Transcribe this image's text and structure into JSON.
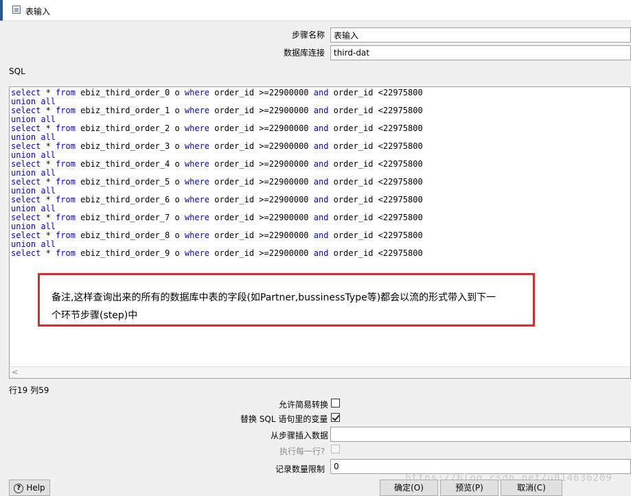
{
  "window": {
    "title": "表输入"
  },
  "form": {
    "step_name_label": "步骤名称",
    "step_name_value": "表输入",
    "connection_label": "数据库连接",
    "connection_value": "third-dat",
    "sql_label": "SQL"
  },
  "sql_lines": [
    [
      {
        "t": "select",
        "k": true
      },
      {
        "t": " * "
      },
      {
        "t": "from",
        "k": true
      },
      {
        "t": " ebiz_third_order_0 o "
      },
      {
        "t": "where",
        "k": true
      },
      {
        "t": " order_id >=22900000 "
      },
      {
        "t": "and",
        "k": true
      },
      {
        "t": " order_id <22975800"
      }
    ],
    [
      {
        "t": "union all",
        "k": true
      }
    ],
    [
      {
        "t": "select",
        "k": true
      },
      {
        "t": " * "
      },
      {
        "t": "from",
        "k": true
      },
      {
        "t": " ebiz_third_order_1 o "
      },
      {
        "t": "where",
        "k": true
      },
      {
        "t": " order_id >=22900000 "
      },
      {
        "t": "and",
        "k": true
      },
      {
        "t": " order_id <22975800"
      }
    ],
    [
      {
        "t": "union all",
        "k": true
      }
    ],
    [
      {
        "t": "select",
        "k": true
      },
      {
        "t": " * "
      },
      {
        "t": "from",
        "k": true
      },
      {
        "t": " ebiz_third_order_2 o "
      },
      {
        "t": "where",
        "k": true
      },
      {
        "t": " order_id >=22900000 "
      },
      {
        "t": "and",
        "k": true
      },
      {
        "t": " order_id <22975800"
      }
    ],
    [
      {
        "t": "union all",
        "k": true
      }
    ],
    [
      {
        "t": "select",
        "k": true
      },
      {
        "t": " * "
      },
      {
        "t": "from",
        "k": true
      },
      {
        "t": " ebiz_third_order_3 o "
      },
      {
        "t": "where",
        "k": true
      },
      {
        "t": " order_id >=22900000 "
      },
      {
        "t": "and",
        "k": true
      },
      {
        "t": " order_id <22975800"
      }
    ],
    [
      {
        "t": "union all",
        "k": true
      }
    ],
    [
      {
        "t": "select",
        "k": true
      },
      {
        "t": " * "
      },
      {
        "t": "from",
        "k": true
      },
      {
        "t": " ebiz_third_order_4 o "
      },
      {
        "t": "where",
        "k": true
      },
      {
        "t": " order_id >=22900000 "
      },
      {
        "t": "and",
        "k": true
      },
      {
        "t": " order_id <22975800"
      }
    ],
    [
      {
        "t": "union all",
        "k": true
      }
    ],
    [
      {
        "t": "select",
        "k": true
      },
      {
        "t": " * "
      },
      {
        "t": "from",
        "k": true
      },
      {
        "t": " ebiz_third_order_5 o "
      },
      {
        "t": "where",
        "k": true
      },
      {
        "t": " order_id >=22900000 "
      },
      {
        "t": "and",
        "k": true
      },
      {
        "t": " order_id <22975800"
      }
    ],
    [
      {
        "t": "union all",
        "k": true
      }
    ],
    [
      {
        "t": "select",
        "k": true
      },
      {
        "t": " * "
      },
      {
        "t": "from",
        "k": true
      },
      {
        "t": " ebiz_third_order_6 o "
      },
      {
        "t": "where",
        "k": true
      },
      {
        "t": " order_id >=22900000 "
      },
      {
        "t": "and",
        "k": true
      },
      {
        "t": " order_id <22975800"
      }
    ],
    [
      {
        "t": "union all",
        "k": true
      }
    ],
    [
      {
        "t": "select",
        "k": true
      },
      {
        "t": " * "
      },
      {
        "t": "from",
        "k": true
      },
      {
        "t": " ebiz_third_order_7 o "
      },
      {
        "t": "where",
        "k": true
      },
      {
        "t": " order_id >=22900000 "
      },
      {
        "t": "and",
        "k": true
      },
      {
        "t": " order_id <22975800"
      }
    ],
    [
      {
        "t": "union all",
        "k": true
      }
    ],
    [
      {
        "t": "select",
        "k": true
      },
      {
        "t": " * "
      },
      {
        "t": "from",
        "k": true
      },
      {
        "t": " ebiz_third_order_8 o "
      },
      {
        "t": "where",
        "k": true
      },
      {
        "t": " order_id >=22900000 "
      },
      {
        "t": "and",
        "k": true
      },
      {
        "t": " order_id <22975800"
      }
    ],
    [
      {
        "t": "union all",
        "k": true
      }
    ],
    [
      {
        "t": "select",
        "k": true
      },
      {
        "t": " * "
      },
      {
        "t": "from",
        "k": true
      },
      {
        "t": " ebiz_third_order_9 o "
      },
      {
        "t": "where",
        "k": true
      },
      {
        "t": " order_id >=22900000 "
      },
      {
        "t": "and",
        "k": true
      },
      {
        "t": " order_id <22975800"
      }
    ]
  ],
  "annotation": {
    "line1": "备注,这样查询出来的所有的数据库中表的字段(如Partner,bussinessType等)都会以流的形式带入到下一",
    "line2": "个环节步骤(step)中",
    "border_color": "#d82b2b"
  },
  "status": {
    "cursor_position": "行19 列59"
  },
  "options": {
    "lazy_conversion_label": "允许简易转换",
    "lazy_conversion_checked": false,
    "replace_variables_label": "替换 SQL 语句里的变量",
    "replace_variables_checked": true,
    "insert_from_step_label": "从步骤插入数据",
    "insert_from_step_value": "",
    "execute_each_row_label": "执行每一行?",
    "execute_each_row_checked": false,
    "execute_each_row_disabled": true,
    "limit_label": "记录数量限制",
    "limit_value": "0"
  },
  "buttons": {
    "help": "Help",
    "ok": "确定(O)",
    "preview": "预览(P)",
    "cancel": "取消(C)"
  },
  "watermark": "https://blog.csdn.net/u014636209",
  "colors": {
    "keyword": "#0000e6"
  }
}
